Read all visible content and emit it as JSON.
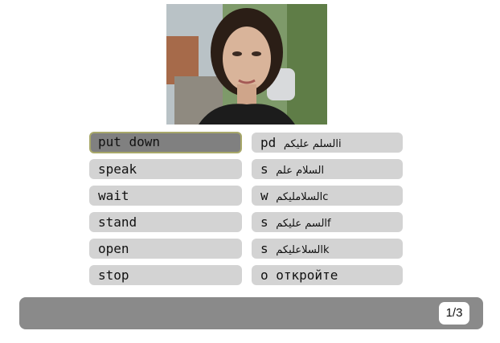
{
  "words": {
    "left": [
      "put down",
      "speak",
      "wait",
      "stand",
      "open",
      "stop"
    ],
    "right": [
      {
        "prefix": "pd ",
        "rest": "السلم  عليكمi"
      },
      {
        "prefix": "s ",
        "rest": "السلام  علم"
      },
      {
        "prefix": "w ",
        "rest": "السلامليكمc"
      },
      {
        "prefix": "s ",
        "rest": "السم  عليكمf"
      },
      {
        "prefix": "s ",
        "rest": "السلاعليكمk"
      },
      {
        "prefix": "o ",
        "rest": "откройте"
      }
    ],
    "selected_left_index": 0
  },
  "footer": {
    "counter": "1/3"
  },
  "colors": {
    "pill": "#d3d3d3",
    "selected": "#808080",
    "selected_border": "#a8a86a",
    "bar": "#8a8a8a"
  }
}
